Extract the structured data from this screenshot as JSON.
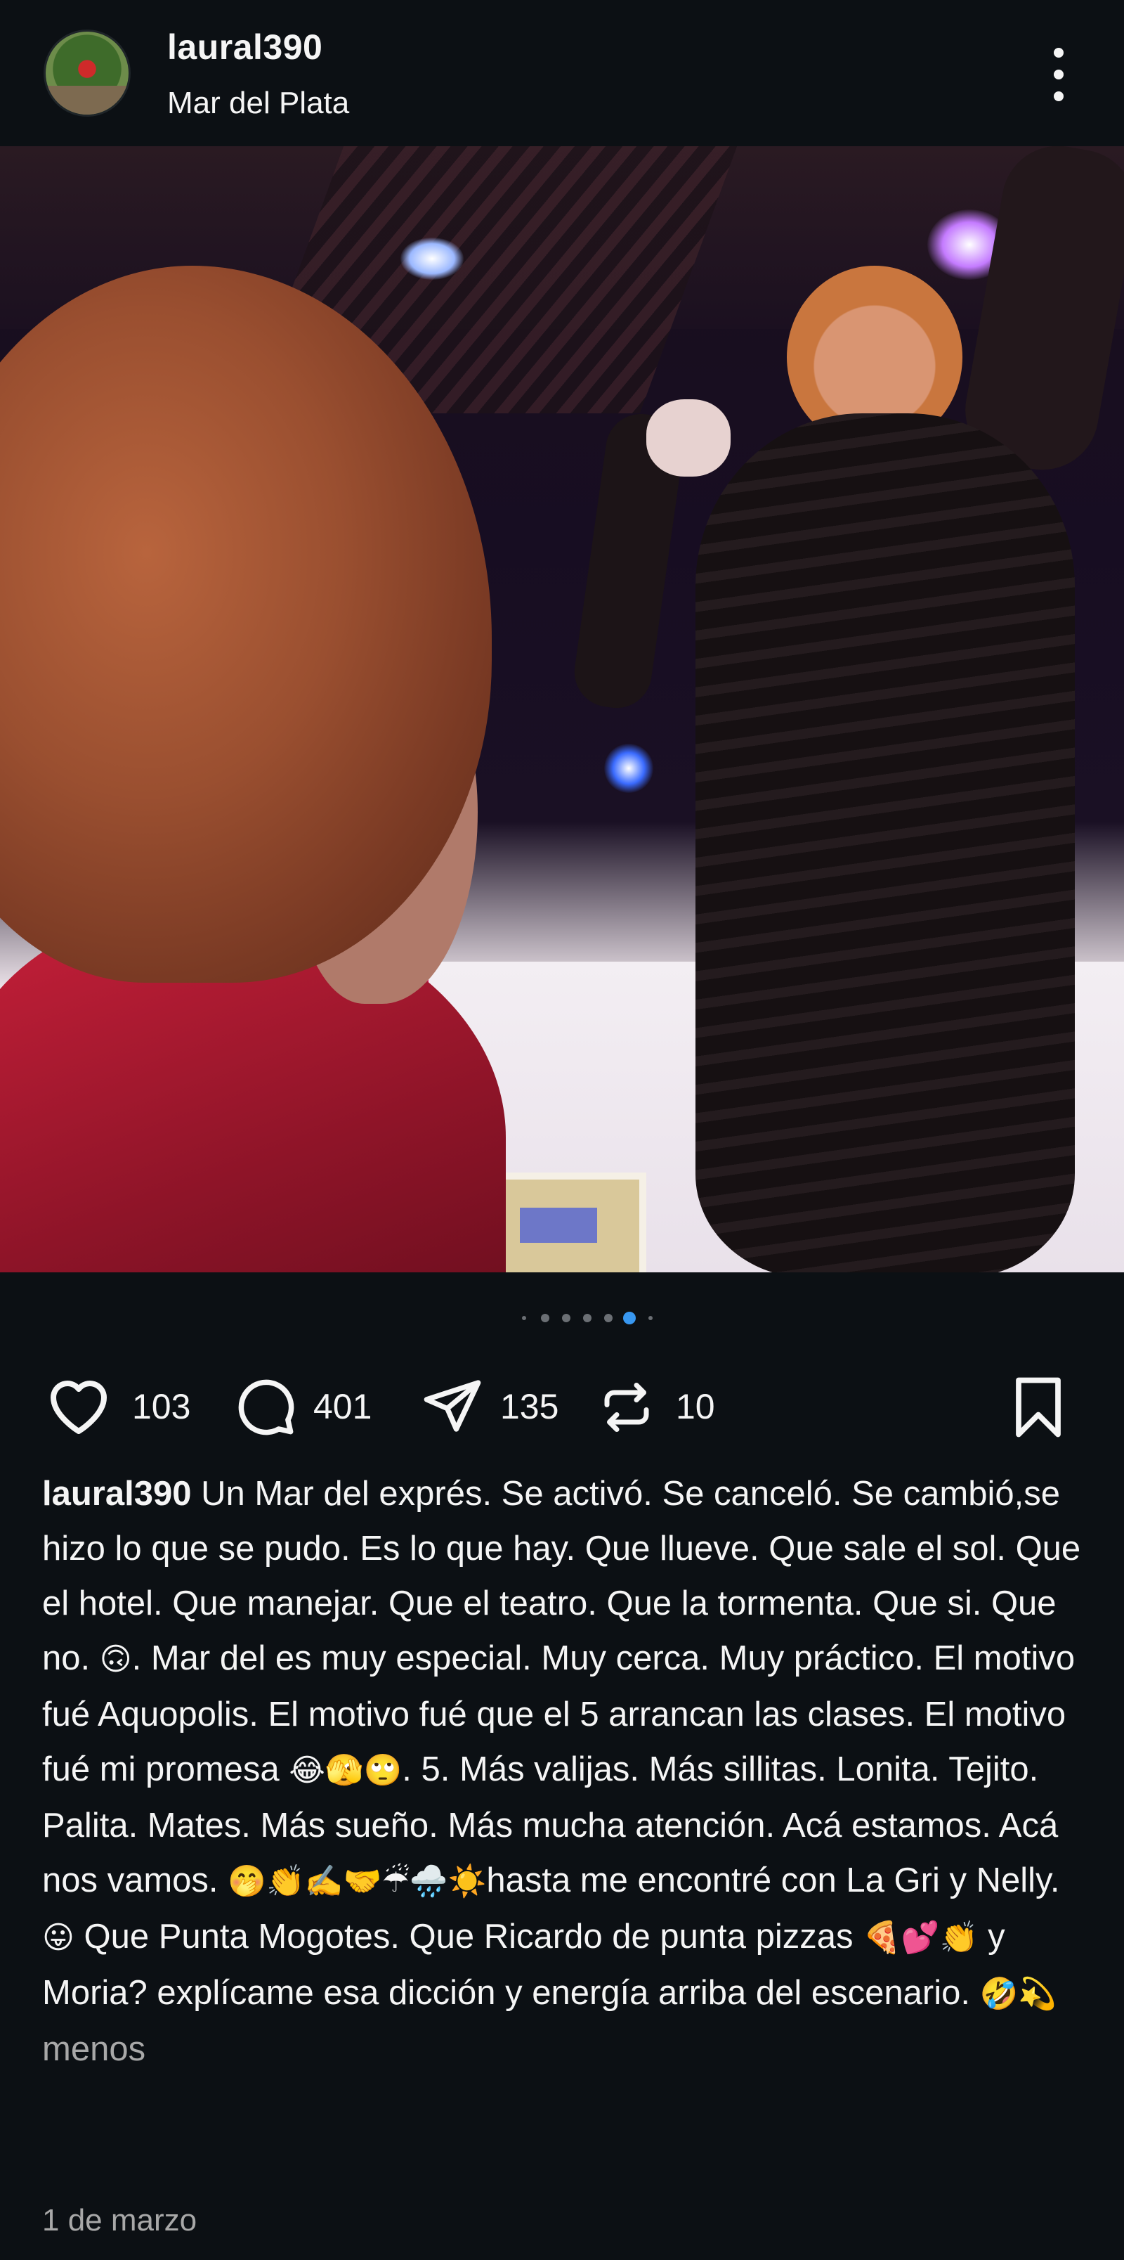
{
  "post": {
    "username": "laural390",
    "location": "Mar del Plata",
    "more_icon": "more-vertical-icon"
  },
  "media": {
    "carousel_count": 7,
    "carousel_active_index": 5,
    "mute_icon": "volume-off-icon"
  },
  "actions": {
    "like_count": "103",
    "comment_count": "401",
    "share_count": "135",
    "repost_count": "10",
    "icons": [
      "heart-icon",
      "comment-icon",
      "send-icon",
      "repost-icon",
      "bookmark-icon"
    ]
  },
  "caption": {
    "author": "laural390",
    "text_1": " Un Mar del exprés. Se activó. Se canceló. Se cambió,se hizo lo que se pudo. Es lo que hay. Que llueve. Que sale el sol. Que el hotel. Que manejar. Que el teatro. Que la tormenta. Que si. Que no. ",
    "emoji_1": "🙃",
    "text_2": ". Mar del es muy especial. Muy cerca. Muy práctico. El motivo fué Aquopolis. El motivo fué que el 5 arrancan las clases. El motivo fué mi promesa ",
    "emoji_2": "😂🫣🙄",
    "text_3": ". 5. Más valijas. Más sillitas. Lonita. Tejito. Palita. Mates. Más sueño. Más mucha atención. Acá estamos. Acá nos vamos. ",
    "emoji_3": "🤭👏✍️🤝☔🌧️☀️",
    "text_4": "hasta me encontré con La Gri y Nelly. ",
    "emoji_4": "😛",
    "text_5": " Que Punta Mogotes. Que Ricardo de punta pizzas ",
    "emoji_5": "🍕💕👏",
    "text_6": " y Moria? explícame esa dicción y energía arriba del escenario. ",
    "emoji_6": "🤣💫",
    "less_label": "menos"
  },
  "date": "1 de marzo",
  "colors": {
    "background": "#0c1014",
    "text": "#f5f5f5",
    "muted": "#a8a8a8",
    "accent": "#3897f0"
  }
}
